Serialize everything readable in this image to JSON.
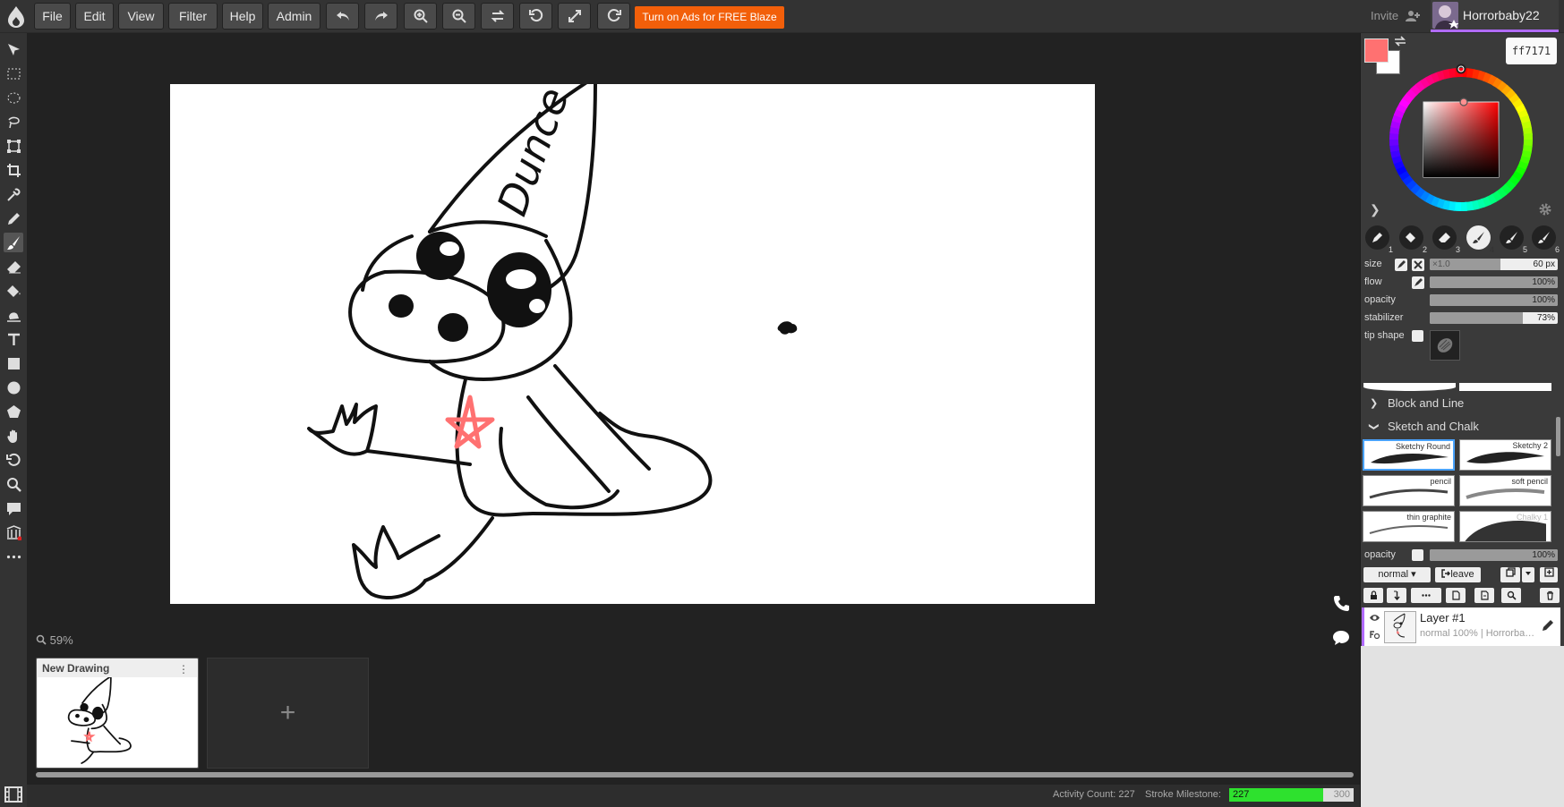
{
  "topbar": {
    "menu": [
      "File",
      "Edit",
      "View",
      "Filter",
      "Help",
      "Admin"
    ],
    "ads_button": "Turn on Ads for FREE Blaze 🔥",
    "invite": "Invite",
    "username": "Horrorbaby22"
  },
  "canvas": {
    "zoom": "59%",
    "drawing_text": "Dunce"
  },
  "thumbnails": {
    "title": "New Drawing",
    "menu_glyph": "⋮",
    "add_glyph": "+"
  },
  "status": {
    "activity": "Activity Count: 227",
    "milestone_label": "Stroke Milestone:",
    "milestone_value": "227",
    "milestone_max": "300",
    "milestone_progress": 0.757
  },
  "color": {
    "primary": "#ff7171",
    "secondary": "#ffffff",
    "hex": "ff7171"
  },
  "brush_slots": [
    "1",
    "2",
    "3",
    "4",
    "5",
    "6"
  ],
  "brush_props": {
    "size_label": "size",
    "size_mult": "×1.0",
    "size_value": "60 px",
    "size_fraction": 0.55,
    "flow_label": "flow",
    "flow_value": "100%",
    "flow_fraction": 1.0,
    "opacity_label": "opacity",
    "opacity_value": "100%",
    "opacity_fraction": 1.0,
    "stabilizer_label": "stabilizer",
    "stabilizer_value": "73%",
    "stabilizer_fraction": 0.73,
    "tip_label": "tip shape"
  },
  "brush_groups": [
    {
      "name": "Block and Line",
      "chevron": "❯"
    },
    {
      "name": "Sketch and Chalk",
      "chevron": "❯"
    }
  ],
  "brushes": [
    "Sketchy Round",
    "Sketchy 2",
    "pencil",
    "soft pencil",
    "thin graphite",
    "Chalky 1"
  ],
  "layer_panel": {
    "opacity_label": "opacity",
    "opacity_value": "100%",
    "opacity_fraction": 1.0,
    "blend_mode": "normal ▾",
    "leave": "leave",
    "layer_name": "Layer #1",
    "layer_meta": "normal 100% | Horrorba…"
  }
}
